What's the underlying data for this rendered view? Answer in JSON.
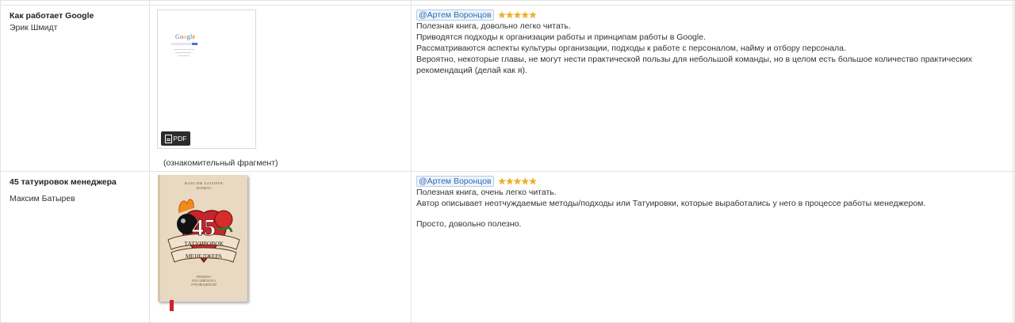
{
  "books": [
    {
      "title": "Как работает Google",
      "author": "Эрик Шмидт",
      "cover": {
        "logo_text": "Google",
        "badge_label": "PDF"
      },
      "caption": "(ознакомительный фрагмент)",
      "review": {
        "user": "@Артем Воронцов",
        "rating": 5,
        "stars": "★★★★★",
        "lines": [
          "Полезная книга, довольно легко читать.",
          "Приводятся подходы к организации работы и принципам работы в Google.",
          "Рассматриваются аспекты культуры организации, подходы к работе с персоналом, найму и отбору персонала.",
          "Вероятно, некоторые главы, не могут нести практической пользы для небольшой команды, но в целом есть большое количество практических рекомендаций (делай как я)."
        ]
      }
    },
    {
      "title": "45 татуировок менеджера",
      "author": "Максим Батырев",
      "cover": {
        "author_text": "МАКСИМ БАТЫРЕВ",
        "sub_text": "(КОМБАТ)",
        "big_number": "45",
        "ribbon_top": "ТАТУИРОВОК",
        "ribbon_bottom": "МЕНЕДЖЕРА",
        "foot_line1": "ПРАВИЛА",
        "foot_line2": "РОССИЙСКОГО",
        "foot_line3": "РУКОВОДИТЕЛЯ"
      },
      "review": {
        "user": "@Артем Воронцов",
        "rating": 5,
        "stars": "★★★★★",
        "lines": [
          "Полезная книга, очень легко читать.",
          "Автор описывает неотчуждаемые методы/подходы или Татуировки, которые выработались у него в процессе работы менеджером."
        ],
        "after_gap": "Просто, довольно полезно."
      }
    }
  ],
  "colors": {
    "user_tag": "#2a6cb5",
    "stars": "#f2b01e",
    "border": "#e4e4e4",
    "cover_bg": "#ead9c2",
    "cover_red": "#c8242b"
  }
}
